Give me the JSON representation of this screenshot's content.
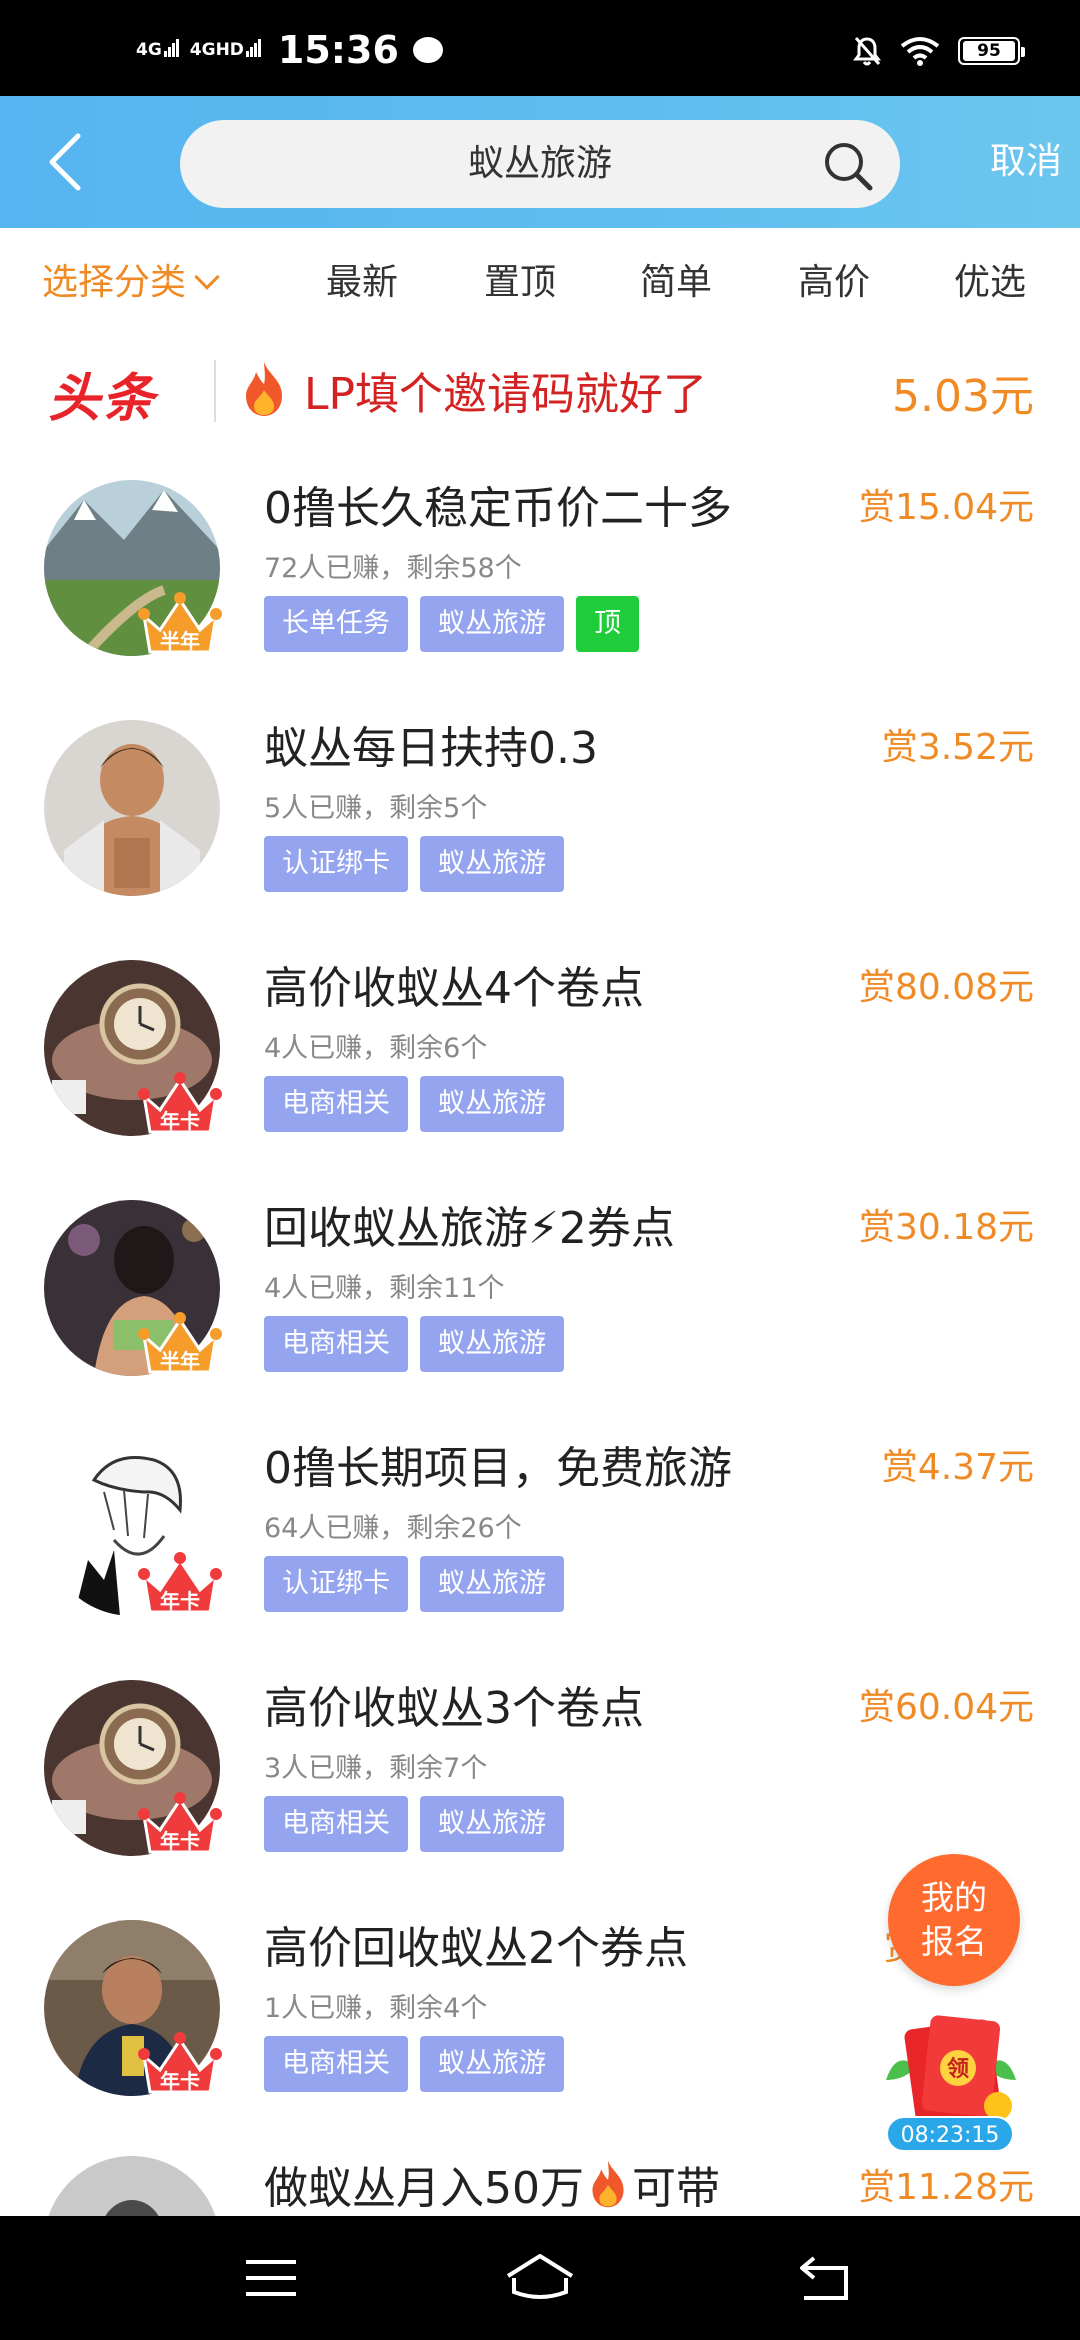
{
  "status_bar": {
    "network1": "4G",
    "network2": "4GHD",
    "time": "15:36",
    "battery": "95"
  },
  "header": {
    "search_value": "蚁丛旅游",
    "cancel_label": "取消"
  },
  "tabs": [
    {
      "label": "选择分类",
      "active": true
    },
    {
      "label": "最新"
    },
    {
      "label": "置顶"
    },
    {
      "label": "简单"
    },
    {
      "label": "高价"
    },
    {
      "label": "优选"
    }
  ],
  "headline": {
    "brand": "头条",
    "text": "LP填个邀请码就好了",
    "amount": "5.03元"
  },
  "tasks": [
    {
      "title": "0撸长久稳定币价二十多",
      "reward": "赏15.04元",
      "meta": "72人已赚，剩余58个",
      "tags": [
        "长单任务",
        "蚁丛旅游"
      ],
      "top_tag": "顶",
      "badge": "半年"
    },
    {
      "title": "蚁丛每日扶持0.3",
      "reward": "赏3.52元",
      "meta": "5人已赚，剩余5个",
      "tags": [
        "认证绑卡",
        "蚁丛旅游"
      ]
    },
    {
      "title": "高价收蚁丛4个卷点",
      "reward": "赏80.08元",
      "meta": "4人已赚，剩余6个",
      "tags": [
        "电商相关",
        "蚁丛旅游"
      ],
      "badge": "年卡"
    },
    {
      "title": "回收蚁丛旅游⚡2券点",
      "reward": "赏30.18元",
      "meta": "4人已赚，剩余11个",
      "tags": [
        "电商相关",
        "蚁丛旅游"
      ],
      "badge": "半年"
    },
    {
      "title": "0撸长期项目，免费旅游",
      "reward": "赏4.37元",
      "meta": "64人已赚，剩余26个",
      "tags": [
        "认证绑卡",
        "蚁丛旅游"
      ],
      "badge": "年卡"
    },
    {
      "title": "高价收蚁丛3个卷点",
      "reward": "赏60.04元",
      "meta": "3人已赚，剩余7个",
      "tags": [
        "电商相关",
        "蚁丛旅游"
      ],
      "badge": "年卡"
    },
    {
      "title": "高价回收蚁丛2个券点",
      "reward": "赏",
      "meta": "1人已赚，剩余4个",
      "tags": [
        "电商相关",
        "蚁丛旅游"
      ],
      "badge": "年卡"
    },
    {
      "title": "做蚁丛月入50万",
      "title_suffix": "可带",
      "reward": "赏11.28元",
      "meta": "",
      "tags": []
    }
  ],
  "floating": {
    "signup_line1": "我的",
    "signup_line2": "报名",
    "redpacket_char": "领",
    "timer": "08:23:15"
  },
  "colors": {
    "accent_orange": "#f08a24",
    "header_blue": "#5fbdf0",
    "tag_purple": "#94a4ee",
    "tag_green": "#1fcd3a",
    "brand_red": "#e8242a"
  }
}
